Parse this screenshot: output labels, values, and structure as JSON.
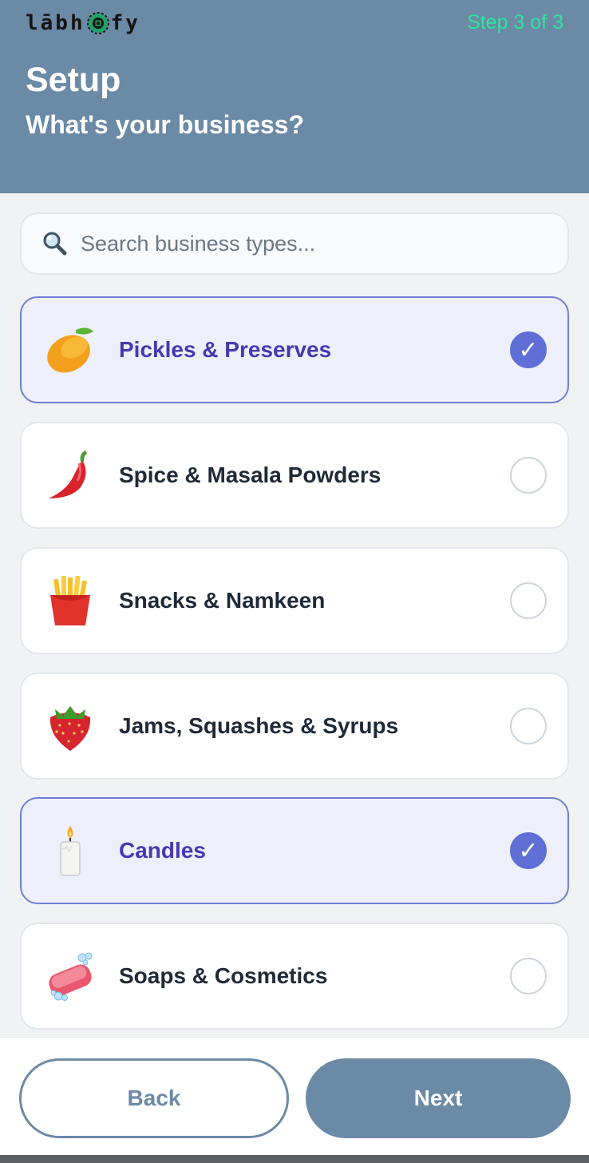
{
  "header": {
    "logo_left": "lābh",
    "logo_right": "fy",
    "step": "Step 3 of 3",
    "title": "Setup",
    "subtitle": "What's your business?"
  },
  "search": {
    "placeholder": "Search business types..."
  },
  "business_types": [
    {
      "label": "Pickles & Preserves",
      "icon": "mango-icon",
      "selected": true
    },
    {
      "label": "Spice & Masala Powders",
      "icon": "chili-pepper-icon",
      "selected": false
    },
    {
      "label": "Snacks & Namkeen",
      "icon": "fries-icon",
      "selected": false
    },
    {
      "label": "Jams, Squashes & Syrups",
      "icon": "strawberry-icon",
      "selected": false
    },
    {
      "label": "Candles",
      "icon": "candle-icon",
      "selected": true
    },
    {
      "label": "Soaps & Cosmetics",
      "icon": "soap-icon",
      "selected": false
    }
  ],
  "check_glyph": "✓",
  "footer": {
    "back_label": "Back",
    "next_label": "Next"
  },
  "colors": {
    "header_bg": "#6b8aa6",
    "step_text": "#2ee5a0",
    "selected_bg": "#edf0fb",
    "selected_border": "#6f7fd4",
    "selected_text": "#4838b0",
    "check_bg": "#5f6fd6"
  }
}
